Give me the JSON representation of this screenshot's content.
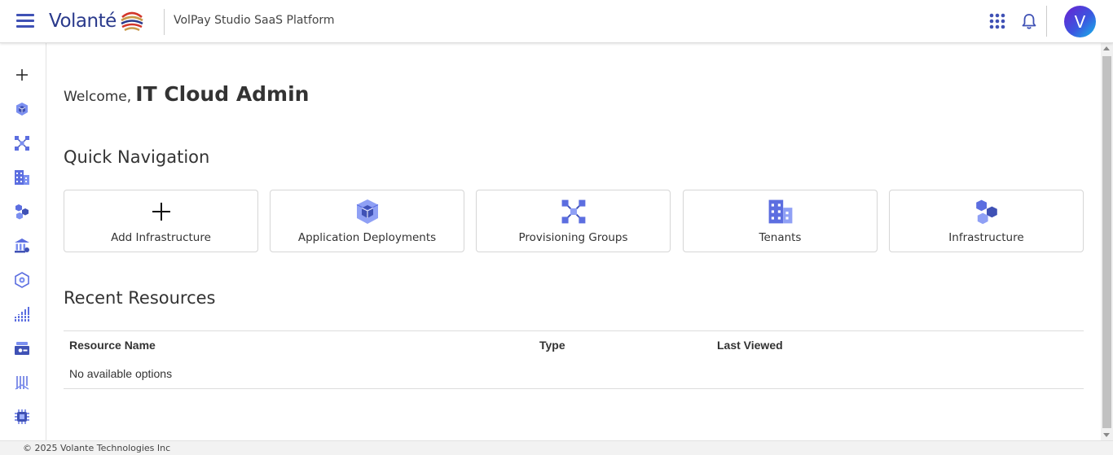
{
  "header": {
    "logo_text": "Volanté",
    "app_title": "VolPay Studio SaaS Platform",
    "avatar_initial": "V",
    "icons": [
      "menu-icon",
      "apps-grid-icon",
      "bell-icon"
    ],
    "accent_color": "#3f51b5"
  },
  "sidebar": {
    "items": [
      {
        "icon": "plus-icon"
      },
      {
        "icon": "application-deployments-icon"
      },
      {
        "icon": "provisioning-groups-icon"
      },
      {
        "icon": "tenants-icon"
      },
      {
        "icon": "infrastructure-icon"
      },
      {
        "icon": "bank-icon"
      },
      {
        "icon": "settings-cube-icon"
      },
      {
        "icon": "analytics-icon"
      },
      {
        "icon": "storage-icon"
      },
      {
        "icon": "ledger-icon"
      },
      {
        "icon": "chip-icon"
      }
    ]
  },
  "main": {
    "welcome_prefix": "Welcome,",
    "welcome_name": "IT Cloud Admin",
    "quick_nav_title": "Quick Navigation",
    "quick_nav": [
      {
        "label": "Add Infrastructure",
        "icon": "plus-icon"
      },
      {
        "label": "Application Deployments",
        "icon": "application-deployments-icon"
      },
      {
        "label": "Provisioning Groups",
        "icon": "provisioning-groups-icon"
      },
      {
        "label": "Tenants",
        "icon": "tenants-icon"
      },
      {
        "label": "Infrastructure",
        "icon": "infrastructure-icon"
      }
    ],
    "recent_title": "Recent Resources",
    "table": {
      "columns": [
        "Resource Name",
        "Type",
        "Last Viewed"
      ],
      "empty_text": "No available options"
    }
  },
  "footer": {
    "text": "© 2025 Volante Technologies Inc"
  }
}
